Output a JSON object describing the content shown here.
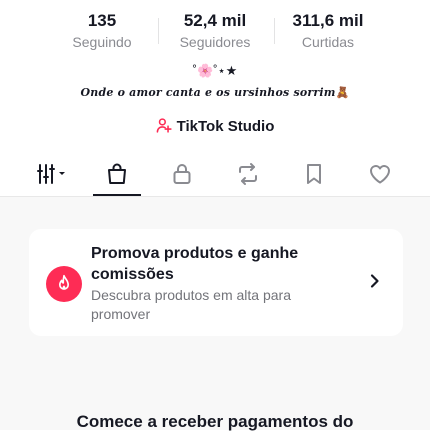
{
  "stats": [
    {
      "value": "135",
      "label": "Seguindo"
    },
    {
      "value": "52,4 mil",
      "label": "Seguidores"
    },
    {
      "value": "311,6 mil",
      "label": "Curtidas"
    }
  ],
  "bio": {
    "decoration": "˚🌸˚⋆★",
    "text": "Onde o amor canta e os ursinhos sorrim",
    "emoji": "🧸"
  },
  "studio": {
    "label": "TikTok Studio"
  },
  "tabs": [
    {
      "icon": "grid-filter-icon",
      "active": false
    },
    {
      "icon": "shopping-bag-icon",
      "active": true
    },
    {
      "icon": "lock-icon",
      "active": false
    },
    {
      "icon": "repost-icon",
      "active": false
    },
    {
      "icon": "bookmark-icon",
      "active": false
    },
    {
      "icon": "heart-icon",
      "active": false
    }
  ],
  "promo": {
    "title": "Promova produtos e ganhe comissões",
    "subtitle": "Descubra produtos em alta para promover",
    "icon": "flame-icon",
    "accent": "#fe2c55"
  },
  "bottom": {
    "title": "Comece a receber pagamentos do"
  }
}
